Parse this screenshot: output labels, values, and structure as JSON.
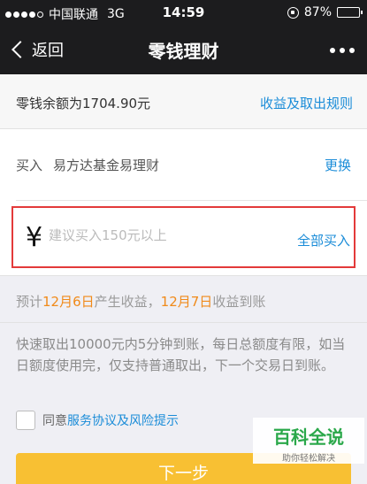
{
  "status_bar": {
    "carrier": "中国联通",
    "network": "3G",
    "time": "14:59",
    "battery": "87%",
    "battery_level": 0.87
  },
  "nav": {
    "back_label": "返回",
    "title": "零钱理财"
  },
  "balance": {
    "text": "零钱余额为1704.90元",
    "rules_link": "收益及取出规则"
  },
  "fund": {
    "label": "买入",
    "name": "易方达基金易理财",
    "change_link": "更换"
  },
  "amount": {
    "currency": "¥",
    "placeholder": "建议买入150元以上",
    "value": "",
    "buy_all": "全部买入"
  },
  "estimate": {
    "p1": "预计",
    "date1": "12月6日",
    "p2": "产生收益，",
    "date2": "12月7日",
    "p3": "收益到账"
  },
  "note": "快速取出10000元内5分钟到账，每日总额度有限，如当日额度使用完，仅支持普通取出，下一个交易日到账。",
  "agreement": {
    "prefix": "同意",
    "terms": "服务协议及风险提示",
    "checked": false
  },
  "next_button": "下一步",
  "watermark": {
    "title": "百科全说",
    "subtitle": "助你轻松解决"
  },
  "colors": {
    "link": "#1a8cd8",
    "highlight": "#f08a19",
    "button": "#f8c033",
    "focus_border": "#e33a3a"
  }
}
